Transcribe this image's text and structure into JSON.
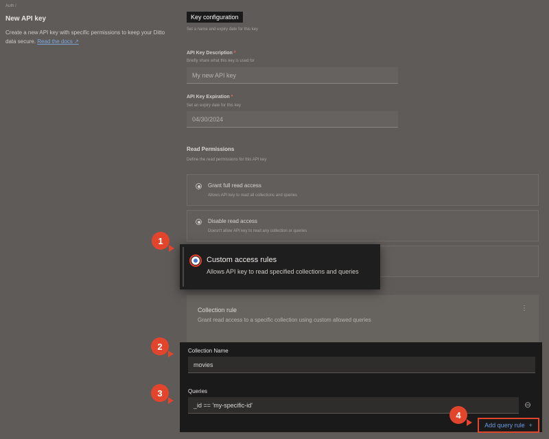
{
  "breadcrumb": "Auth /",
  "page": {
    "title": "New API key",
    "description": "Create a new API key with specific permissions to keep your Ditto data secure.",
    "docs_link": "Read the docs"
  },
  "config": {
    "header": "Key configuration",
    "subtitle": "Set a name and expiry date for this key"
  },
  "description_field": {
    "label": "API Key Description",
    "required": "*",
    "help": "Briefly share what this key is used for",
    "placeholder": "My new API key"
  },
  "expiration_field": {
    "label": "API Key Expiration",
    "required": "*",
    "help": "Set an expiry date for this key",
    "value": "04/30/2024"
  },
  "read_permissions": {
    "title": "Read Permissions",
    "subtitle": "Define the read permissions for this API key",
    "options": [
      {
        "title": "Grant full read access",
        "desc": "Allows API key to read all collections and queries"
      },
      {
        "title": "Disable read access",
        "desc": "Doesn't allow API key to read any collection or queries"
      },
      {
        "title": "Custom access rules",
        "desc": "Allows API key to read specified collections and queries"
      }
    ]
  },
  "collection_rule": {
    "title": "Collection rule",
    "subtitle": "Grant read access to a specific collection using custom allowed queries",
    "menu": "⋮"
  },
  "collection_name": {
    "label": "Collection Name",
    "value": "movies"
  },
  "queries": {
    "label": "Queries",
    "value": "_id == 'my-specific-id'",
    "remove": "⊖"
  },
  "add_query_rule": {
    "label": "Add query rule",
    "plus": "+"
  },
  "badges": [
    "1",
    "2",
    "3",
    "4"
  ],
  "colors": {
    "accent": "#e2452c",
    "link": "#5b8fd9",
    "background": "#5f5b59",
    "panel": "#1b1a1a"
  }
}
